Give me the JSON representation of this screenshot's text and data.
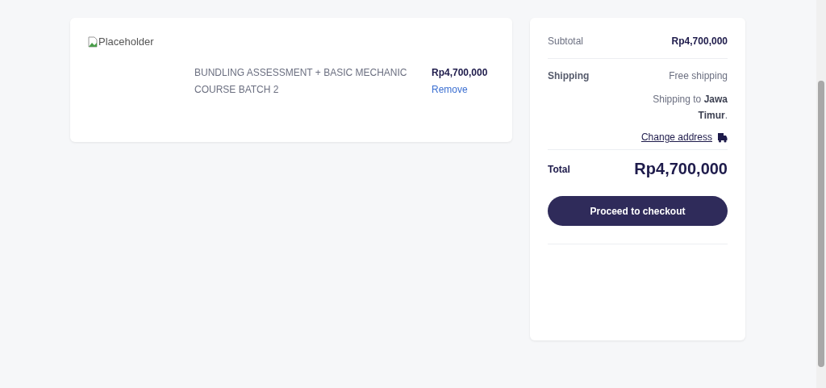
{
  "cart": {
    "items": [
      {
        "image_alt": "Placeholder",
        "name": "BUNDLING ASSESSMENT + BASIC MECHANIC COURSE BATCH 2",
        "price": "Rp4,700,000",
        "remove": "Remove"
      }
    ]
  },
  "summary": {
    "subtotal_label": "Subtotal",
    "subtotal": "Rp4,700,000",
    "shipping_label": "Shipping",
    "shipping_value": "Free shipping",
    "shipping_to": "Shipping to **Jawa Timur**.",
    "change_address": "Change address",
    "total_label": "Total",
    "total": "Rp4,700,000",
    "checkout_button": "Proceed to checkout"
  }
}
